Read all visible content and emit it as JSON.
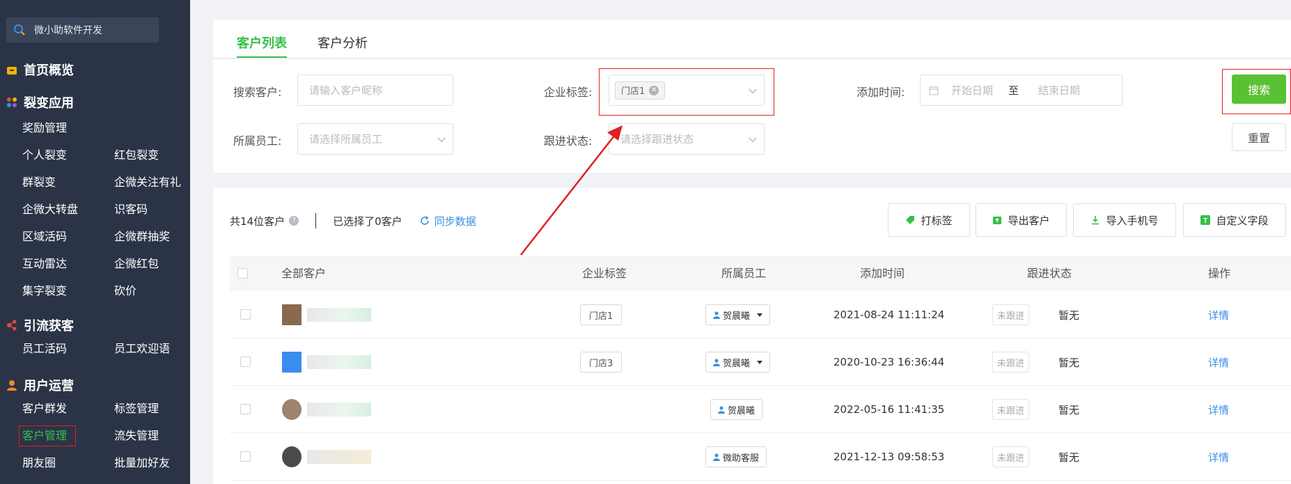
{
  "sidebar": {
    "brand": "微小助软件开发",
    "sections": [
      {
        "title": "首页概览",
        "icon": "home-icon",
        "items": []
      },
      {
        "title": "裂变应用",
        "icon": "apps-icon",
        "items": [
          "奖励管理",
          "",
          "个人裂变",
          "红包裂变",
          "群裂变",
          "企微关注有礼",
          "企微大转盘",
          "识客码",
          "区域活码",
          "企微群抽奖",
          "互动雷达",
          "企微红包",
          "集字裂变",
          "砍价"
        ]
      },
      {
        "title": "引流获客",
        "icon": "share-icon",
        "items": [
          "员工活码",
          "员工欢迎语"
        ]
      },
      {
        "title": "用户运营",
        "icon": "user-icon",
        "items": [
          "客户群发",
          "标签管理",
          "客户管理",
          "流失管理",
          "朋友圈",
          "批量加好友"
        ]
      }
    ]
  },
  "tabs": [
    "客户列表",
    "客户分析"
  ],
  "filters": {
    "search_label": "搜索客户:",
    "search_placeholder": "请输入客户昵称",
    "tag_label": "企业标签:",
    "tag_chip": "门店1",
    "time_label": "添加时间:",
    "start_placeholder": "开始日期",
    "to": "至",
    "end_placeholder": "结束日期",
    "staff_label": "所属员工:",
    "staff_placeholder": "请选择所属员工",
    "status_label": "跟进状态:",
    "status_placeholder": "请选择跟进状态",
    "search_button": "搜索",
    "reset_button": "重置"
  },
  "list": {
    "total": "共14位客户",
    "selected": "已选择了0客户",
    "sync": "同步数据",
    "tools": [
      "打标签",
      "导出客户",
      "导入手机号",
      "自定义字段"
    ],
    "headers": [
      "全部客户",
      "企业标签",
      "所属员工",
      "添加时间",
      "跟进状态",
      "操作"
    ],
    "rows": [
      {
        "tag": "门店1",
        "staff": "贺晨曦",
        "dropdown": true,
        "time": "2021-08-24 11:11:24",
        "status": "未跟进",
        "note": "暂无",
        "action": "详情",
        "avatar": "#8a6a4e"
      },
      {
        "tag": "门店3",
        "staff": "贺晨曦",
        "dropdown": true,
        "time": "2020-10-23 16:36:44",
        "status": "未跟进",
        "note": "暂无",
        "action": "详情",
        "avatar": "#3b8cf0"
      },
      {
        "tag": "",
        "staff": "贺晨曦",
        "dropdown": false,
        "time": "2022-05-16 11:41:35",
        "status": "未跟进",
        "note": "暂无",
        "action": "详情",
        "avatar": "#9c8470"
      },
      {
        "tag": "",
        "staff": "微助客服",
        "dropdown": false,
        "time": "2021-12-13 09:58:53",
        "status": "未跟进",
        "note": "暂无",
        "action": "详情",
        "avatar": "#4a4a4a"
      }
    ]
  },
  "colors": {
    "accent": "#36c04a",
    "link": "#3a8ee6",
    "sidebar": "#2b3447",
    "highlight": "#e02020"
  }
}
